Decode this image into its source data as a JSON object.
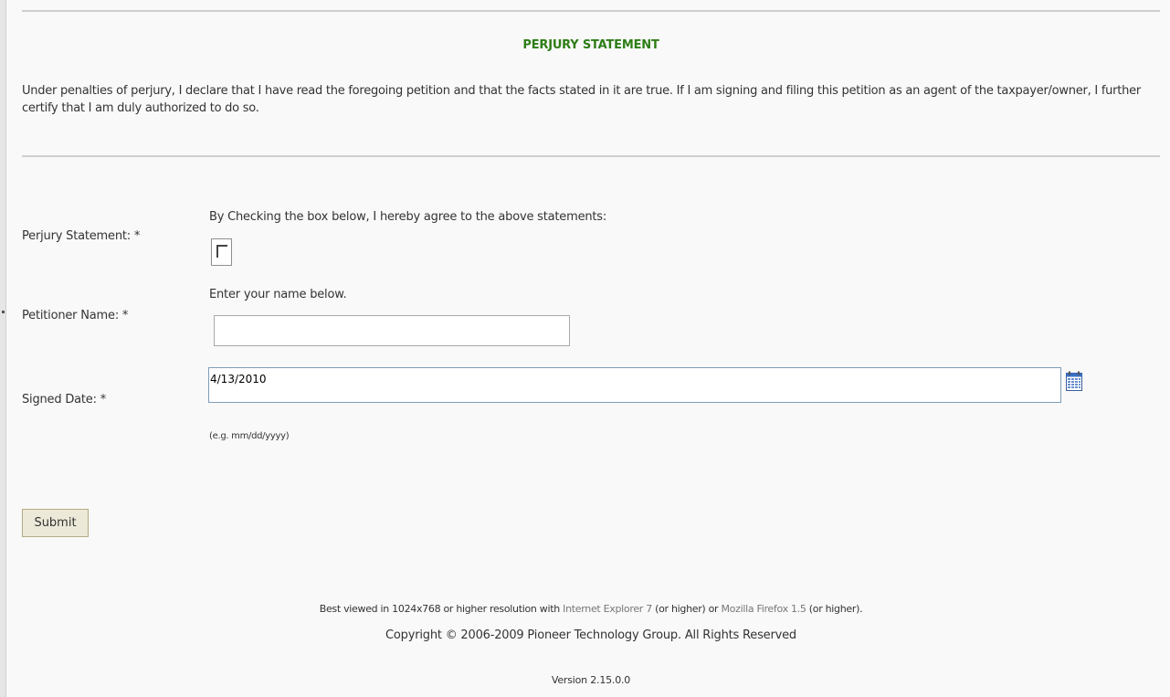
{
  "page": {
    "title": "PERJURY STATEMENT",
    "statement": "Under penalties of perjury, I declare that I have read the foregoing petition and that the facts stated in it are true. If I am signing and filing this petition as an agent of the taxpayer/owner, I further certify that I am duly authorized to do so.",
    "title_color": "#2e7d16"
  },
  "form": {
    "perjury": {
      "label": "Perjury Statement: *",
      "hint": "By Checking the box below, I hereby agree to the above statements:",
      "checked": false
    },
    "petitioner": {
      "label": "Petitioner Name: *",
      "hint": "Enter your name below.",
      "value": ""
    },
    "signed_date": {
      "label": "Signed Date: *",
      "value": "4/13/2010",
      "format_hint": "(e.g. mm/dd/yyyy)",
      "icon": "calendar-icon"
    },
    "submit_label": "Submit"
  },
  "footer": {
    "line1_prefix": "Best viewed in 1024x768 or higher resolution with ",
    "ie_link": "Internet Explorer 7",
    "line1_mid": " (or higher) or ",
    "ff_link": "Mozilla Firefox 1.5",
    "line1_suffix": " (or higher).",
    "copyright": "Copyright © 2006-2009 Pioneer Technology Group. All Rights Reserved",
    "version": "Version 2.15.0.0"
  }
}
